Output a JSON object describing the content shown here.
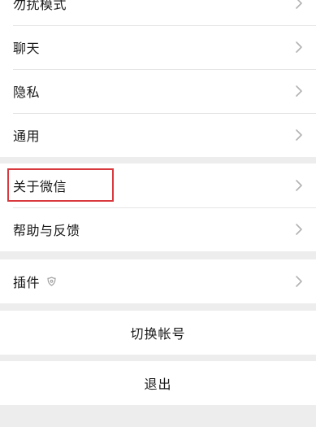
{
  "settings": {
    "items_group1": [
      {
        "label": "勿扰模式",
        "icon": "chevron-right-icon"
      },
      {
        "label": "聊天",
        "icon": "chevron-right-icon"
      },
      {
        "label": "隐私",
        "icon": "chevron-right-icon"
      },
      {
        "label": "通用",
        "icon": "chevron-right-icon"
      }
    ],
    "items_group2": [
      {
        "label": "关于微信",
        "icon": "chevron-right-icon"
      },
      {
        "label": "帮助与反馈",
        "icon": "chevron-right-icon"
      }
    ],
    "items_group3": [
      {
        "label": "插件",
        "badge_icon": "plugin-shield-icon",
        "icon": "chevron-right-icon"
      }
    ],
    "switch_account_label": "切换帐号",
    "logout_label": "退出"
  },
  "annotation": {
    "highlight_color": "#d9393e",
    "highlighted_item": "关于微信"
  }
}
